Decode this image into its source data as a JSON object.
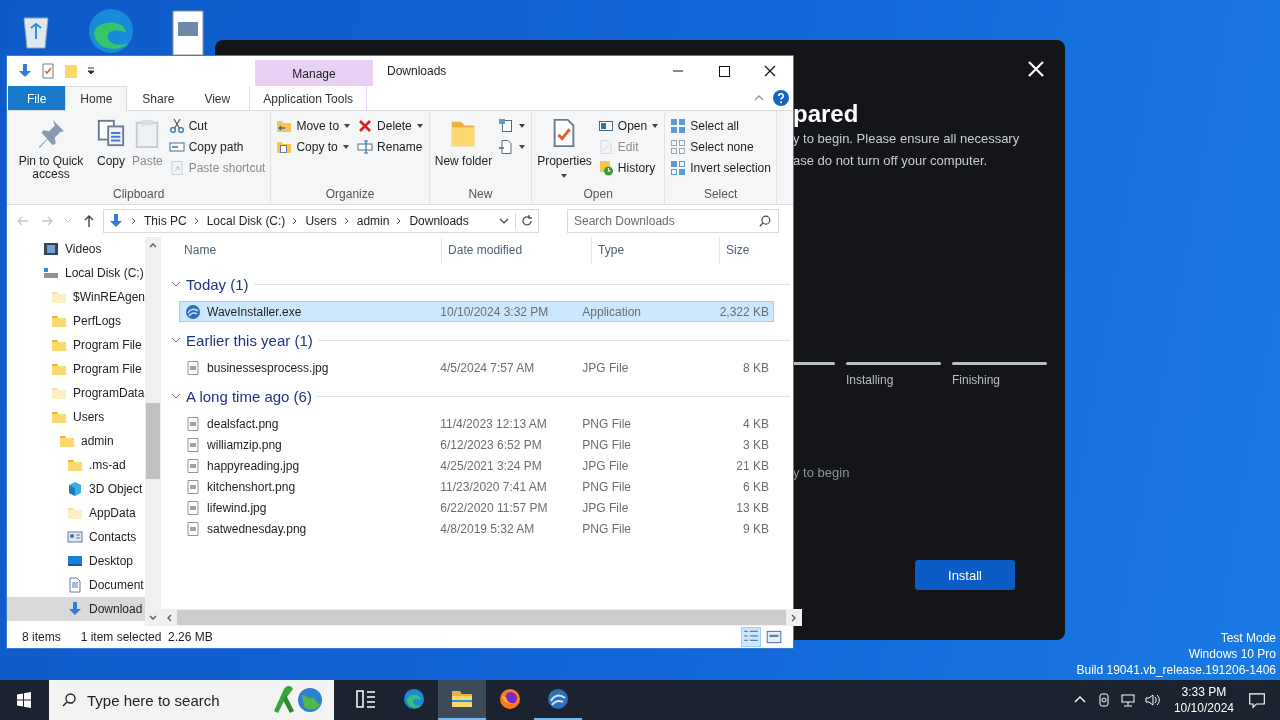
{
  "installer": {
    "title": "pared",
    "text_lines": [
      "y to begin. Please ensure all necessary",
      "ase do not turn off your computer."
    ],
    "steps": [
      {
        "label": "Installing"
      },
      {
        "label": "Finishing"
      }
    ],
    "status": "y to begin",
    "button": "Install"
  },
  "explorer": {
    "context_tab": "Manage",
    "title": "Downloads",
    "tabs": [
      {
        "label": "File",
        "kind": "file",
        "selected": false
      },
      {
        "label": "Home",
        "kind": "tab",
        "selected": true
      },
      {
        "label": "Share",
        "kind": "tab",
        "selected": false
      },
      {
        "label": "View",
        "kind": "tab",
        "selected": false
      },
      {
        "label": "Application Tools",
        "kind": "context",
        "selected": false
      }
    ],
    "ribbon": [
      {
        "label": "Clipboard",
        "columns": [
          [
            {
              "label": "Pin to Quick access",
              "disabled": false,
              "dropdown": false
            }
          ],
          [
            {
              "label": "Copy",
              "disabled": false,
              "dropdown": false
            }
          ],
          [
            {
              "label": "Paste",
              "disabled": true,
              "dropdown": false
            }
          ],
          [
            {
              "label": "Cut",
              "disabled": false,
              "dropdown": false
            },
            {
              "label": "Copy path",
              "disabled": false,
              "dropdown": false
            },
            {
              "label": "Paste shortcut",
              "disabled": true,
              "dropdown": false
            }
          ]
        ]
      },
      {
        "label": "Organize",
        "columns": [
          [
            {
              "label": "Move to",
              "disabled": false,
              "dropdown": true
            },
            {
              "label": "Copy to",
              "disabled": false,
              "dropdown": true
            }
          ],
          [
            {
              "label": "Delete",
              "disabled": false,
              "dropdown": true
            },
            {
              "label": "Rename",
              "disabled": false,
              "dropdown": false
            }
          ]
        ]
      },
      {
        "label": "New",
        "columns": [
          [
            {
              "label": "New folder",
              "disabled": false,
              "dropdown": false
            }
          ],
          [
            {
              "disabled": false,
              "dropdown": true
            },
            {
              "disabled": false,
              "dropdown": true
            }
          ]
        ]
      },
      {
        "label": "Open",
        "columns": [
          [
            {
              "label": "Properties",
              "disabled": false,
              "dropdown": true
            }
          ],
          [
            {
              "label": "Open",
              "disabled": false,
              "dropdown": true
            },
            {
              "label": "Edit",
              "disabled": true,
              "dropdown": false
            },
            {
              "label": "History",
              "disabled": false,
              "dropdown": false
            }
          ]
        ]
      },
      {
        "label": "Select",
        "columns": [
          [
            {
              "label": "Select all",
              "disabled": false,
              "dropdown": false
            },
            {
              "label": "Select none",
              "disabled": false,
              "dropdown": false
            },
            {
              "label": "Invert selection",
              "disabled": false,
              "dropdown": false
            }
          ]
        ]
      }
    ],
    "breadcrumbs": [
      "This PC",
      "Local Disk (C:)",
      "Users",
      "admin",
      "Downloads"
    ],
    "search": {
      "placeholder": "Search Downloads"
    },
    "navigation": [
      {
        "label": "Videos",
        "kind": "videos",
        "hidden": false,
        "selected": false
      },
      {
        "label": "Local Disk (C:)",
        "kind": "drive",
        "hidden": false,
        "selected": false,
        "children": [
          {
            "label": "$WinREAgen",
            "kind": "folder",
            "hidden": true,
            "selected": false
          },
          {
            "label": "PerfLogs",
            "kind": "folder",
            "hidden": false,
            "selected": false
          },
          {
            "label": "Program File",
            "kind": "folder",
            "hidden": false,
            "selected": false
          },
          {
            "label": "Program File",
            "kind": "folder",
            "hidden": false,
            "selected": false
          },
          {
            "label": "ProgramData",
            "kind": "folder",
            "hidden": true,
            "selected": false
          },
          {
            "label": "Users",
            "kind": "folder",
            "hidden": false,
            "selected": false,
            "children": [
              {
                "label": "admin",
                "kind": "folder",
                "hidden": false,
                "selected": false,
                "children": [
                  {
                    "label": ".ms-ad",
                    "kind": "folder",
                    "hidden": false,
                    "selected": false
                  },
                  {
                    "label": "3D Object",
                    "kind": "objects",
                    "hidden": false,
                    "selected": false
                  },
                  {
                    "label": "AppData",
                    "kind": "folder",
                    "hidden": true,
                    "selected": false
                  },
                  {
                    "label": "Contacts",
                    "kind": "contacts",
                    "hidden": false,
                    "selected": false
                  },
                  {
                    "label": "Desktop",
                    "kind": "desktop",
                    "hidden": false,
                    "selected": false
                  },
                  {
                    "label": "Document",
                    "kind": "documents",
                    "hidden": false,
                    "selected": false
                  },
                  {
                    "label": "Download",
                    "kind": "downloads",
                    "hidden": false,
                    "selected": true
                  }
                ]
              }
            ]
          }
        ]
      }
    ],
    "columns": [
      "Name",
      "Date modified",
      "Type",
      "Size"
    ],
    "groups": [
      {
        "label": "Today (1)",
        "expanded": true,
        "files": [
          {
            "name": "WaveInstaller.exe",
            "date": "10/10/2024 3:32 PM",
            "type": "Application",
            "size": "2,322 KB",
            "kind": "app",
            "selected": true
          }
        ]
      },
      {
        "label": "Earlier this year (1)",
        "expanded": true,
        "files": [
          {
            "name": "businessesprocess.jpg",
            "date": "4/5/2024 7:57 AM",
            "type": "JPG File",
            "size": "8 KB",
            "kind": "image",
            "selected": false
          }
        ]
      },
      {
        "label": "A long time ago (6)",
        "expanded": true,
        "files": [
          {
            "name": "dealsfact.png",
            "date": "11/4/2023 12:13 AM",
            "type": "PNG File",
            "size": "4 KB",
            "kind": "image",
            "selected": false
          },
          {
            "name": "williamzip.png",
            "date": "6/12/2023 6:52 PM",
            "type": "PNG File",
            "size": "3 KB",
            "kind": "image",
            "selected": false
          },
          {
            "name": "happyreading.jpg",
            "date": "4/25/2021 3:24 PM",
            "type": "JPG File",
            "size": "21 KB",
            "kind": "image",
            "selected": false
          },
          {
            "name": "kitchenshort.png",
            "date": "11/23/2020 7:41 AM",
            "type": "PNG File",
            "size": "6 KB",
            "kind": "image",
            "selected": false
          },
          {
            "name": "lifewind.jpg",
            "date": "6/22/2020 11:57 PM",
            "type": "JPG File",
            "size": "13 KB",
            "kind": "image",
            "selected": false
          },
          {
            "name": "satwednesday.png",
            "date": "4/8/2019 5:32 AM",
            "type": "PNG File",
            "size": "9 KB",
            "kind": "image",
            "selected": false
          }
        ]
      }
    ],
    "status": {
      "count": "8 items",
      "selection": "1 item selected  2.26 MB"
    }
  },
  "system": [
    "Test Mode",
    "Windows 10 Pro",
    "Build 19041.vb_release.191206-1406"
  ],
  "taskbar": {
    "search": {
      "placeholder": "Type here to search"
    },
    "apps": [
      {
        "kind": "taskview",
        "active": false,
        "running": false
      },
      {
        "kind": "edge",
        "active": false,
        "running": false
      },
      {
        "kind": "explorer",
        "active": true,
        "running": true
      },
      {
        "kind": "firefox",
        "active": false,
        "running": false
      },
      {
        "kind": "wave",
        "active": false,
        "running": true
      }
    ],
    "time": "3:33 PM",
    "date": "10/10/2024"
  }
}
